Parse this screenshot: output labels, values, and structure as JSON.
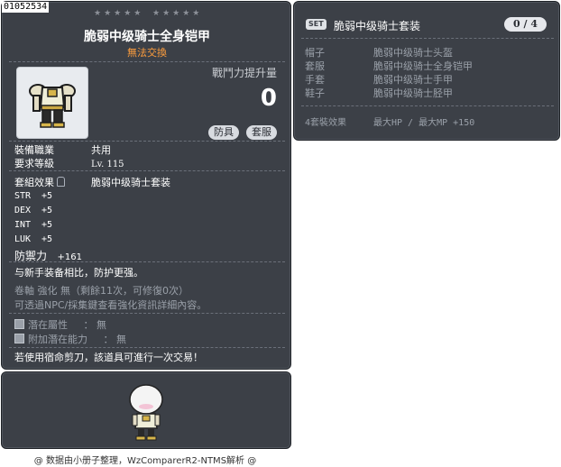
{
  "item": {
    "id": "01052534",
    "name": "脆弱中级骑士全身铠甲",
    "trade_note": "無法交換",
    "power_label": "戰鬥力提升量",
    "power_value": "0",
    "tags": [
      "防具",
      "套服"
    ],
    "job_label": "裝備職業",
    "job_value": "共用",
    "level_label": "要求等級",
    "level_value": "Lv. 115",
    "set_label": "套組效果",
    "set_value": "脆弱中级骑士套装",
    "stats": [
      {
        "name": "STR",
        "value": "+5"
      },
      {
        "name": "DEX",
        "value": "+5"
      },
      {
        "name": "INT",
        "value": "+5"
      },
      {
        "name": "LUK",
        "value": "+5"
      }
    ],
    "defense_label": "防禦力",
    "defense_value": "+161",
    "description": "与新手装备相比，防护更强。",
    "scroll_line": "卷軸 強化 無（剩餘11次，可修復0次）",
    "npc_line": "可透過NPC/採集鍵查看強化資訊詳細內容。",
    "potential_label": "潛在屬性",
    "potential_value": "： 無",
    "additional_label": "附加潛在能力",
    "additional_value": "： 無",
    "scissors_note": "若使用宿命剪刀，該道具可進行一次交易！"
  },
  "footer": "@ 数据由小册子整理，WzComparerR2-NTMS解析 @",
  "set": {
    "badge": "SET",
    "title": "脆弱中级骑士套装",
    "count": "0 / 4",
    "items": [
      {
        "slot": "帽子",
        "name": "脆弱中级骑士头盔"
      },
      {
        "slot": "套服",
        "name": "脆弱中级骑士全身铠甲"
      },
      {
        "slot": "手套",
        "name": "脆弱中级骑士手甲"
      },
      {
        "slot": "鞋子",
        "name": "脆弱中级骑士胫甲"
      }
    ],
    "bonus_label": "4套裝效果",
    "bonus_value": "最大HP / 最大MP  +150"
  },
  "colors": {
    "panel_bg": "#3c4047",
    "trade_note": "#ff9e3d",
    "muted_text": "#9aa0a9"
  }
}
